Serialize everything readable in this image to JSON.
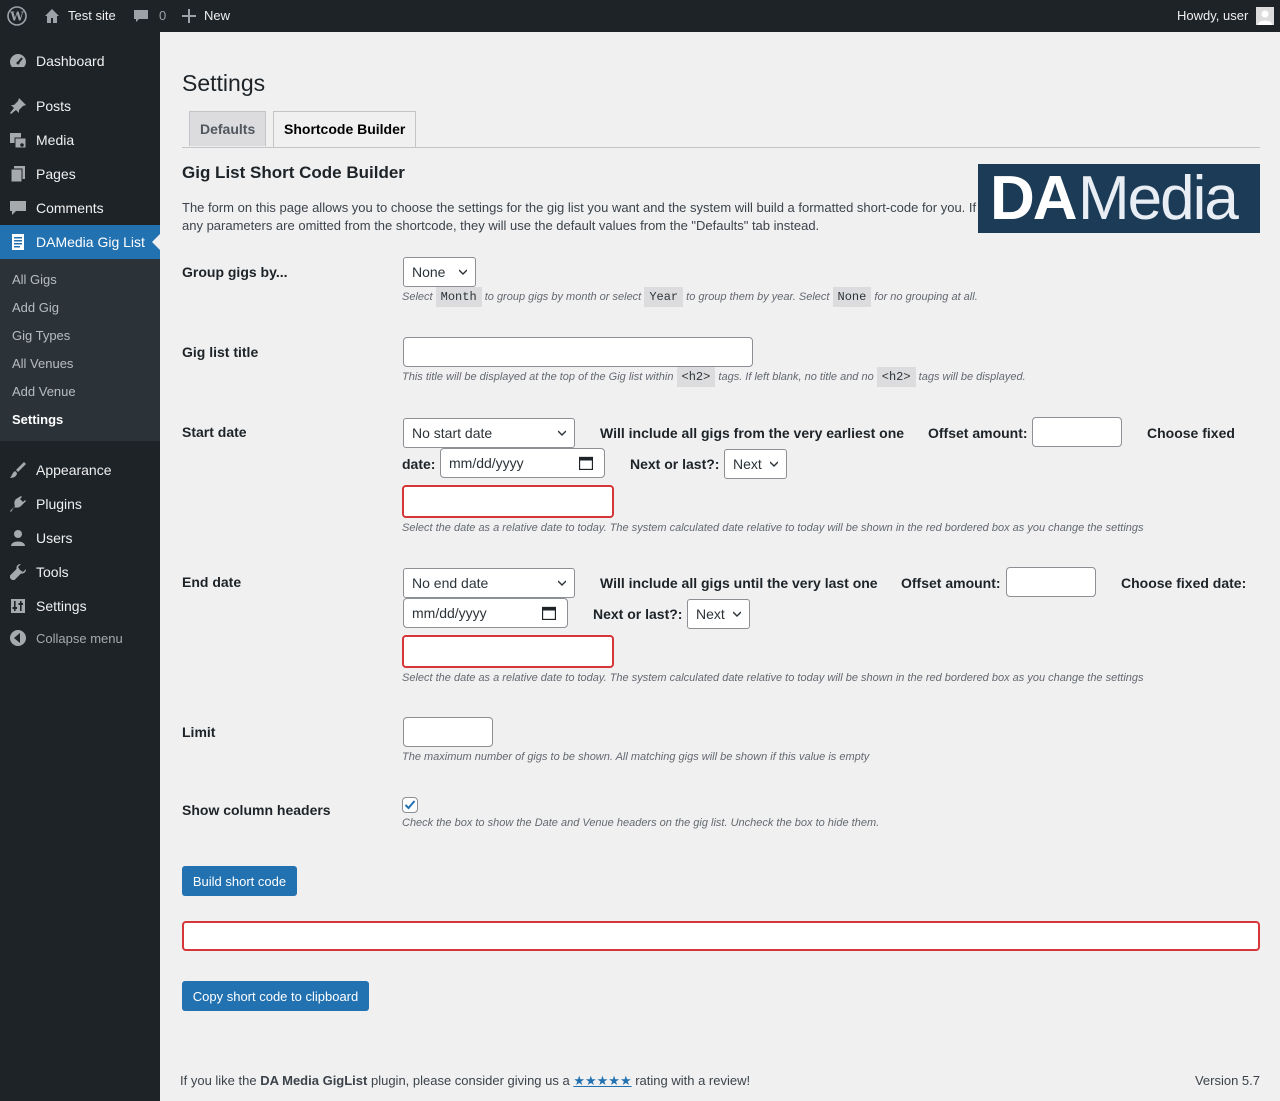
{
  "adminbar": {
    "site_name": "Test site",
    "comments_count": "0",
    "new_label": "New",
    "howdy": "Howdy, user"
  },
  "sidebar": {
    "items": [
      {
        "label": "Dashboard",
        "icon": "dashboard-icon"
      },
      {
        "label": "Posts",
        "icon": "pin-icon"
      },
      {
        "label": "Media",
        "icon": "media-icon"
      },
      {
        "label": "Pages",
        "icon": "pages-icon"
      },
      {
        "label": "Comments",
        "icon": "comments-icon"
      },
      {
        "label": "DAMedia Gig List",
        "icon": "document-icon"
      },
      {
        "label": "Appearance",
        "icon": "brush-icon"
      },
      {
        "label": "Plugins",
        "icon": "plug-icon"
      },
      {
        "label": "Users",
        "icon": "user-icon"
      },
      {
        "label": "Tools",
        "icon": "wrench-icon"
      },
      {
        "label": "Settings",
        "icon": "settings-icon"
      },
      {
        "label": "Collapse menu",
        "icon": "collapse-icon"
      }
    ],
    "submenu": [
      "All Gigs",
      "Add Gig",
      "Gig Types",
      "All Venues",
      "Add Venue",
      "Settings"
    ]
  },
  "page": {
    "title": "Settings",
    "tabs": [
      "Defaults",
      "Shortcode Builder"
    ],
    "heading": "Gig List Short Code Builder",
    "intro": "The form on this page allows you to choose the settings for the gig list you want and the system will build a formatted short-code for you. If any parameters are omitted from the shortcode, they will use the default values from the \"Defaults\" tab instead.",
    "logo_da": "DA",
    "logo_media": "Media"
  },
  "form": {
    "group": {
      "label": "Group gigs by...",
      "value": "None",
      "desc_1": "Select ",
      "code_1": "Month",
      "desc_2": " to group gigs by month or select ",
      "code_2": "Year",
      "desc_3": " to group them by year. Select ",
      "code_3": "None",
      "desc_4": " for no grouping at all."
    },
    "title": {
      "label": "Gig list title",
      "value": "",
      "desc_1": "This title will be displayed at the top of the Gig list within ",
      "code_1": "<h2>",
      "desc_2": " tags. If left blank, no title and no ",
      "code_2": "<h2>",
      "desc_3": " tags will be displayed."
    },
    "start": {
      "label": "Start date",
      "select_value": "No start date",
      "info": "Will include all gigs from the very earliest one",
      "offset_label": "Offset amount:",
      "fixed_label_1": "Choose fixed",
      "fixed_label_2": "date:",
      "date_placeholder": "mm/dd/yyyy",
      "next_label": "Next or last?:",
      "next_value": "Next",
      "desc": "Select the date as a relative date to today. The system calculated date relative to today will be shown in the red bordered box as you change the settings"
    },
    "end": {
      "label": "End date",
      "select_value": "No end date",
      "info": "Will include all gigs until the very last one",
      "offset_label": "Offset amount:",
      "fixed_label": "Choose fixed date:",
      "date_placeholder": "mm/dd/yyyy",
      "next_label": "Next or last?:",
      "next_value": "Next",
      "desc": "Select the date as a relative date to today. The system calculated date relative to today will be shown in the red bordered box as you change the settings"
    },
    "limit": {
      "label": "Limit",
      "value": "",
      "desc": "The maximum number of gigs to be shown. All matching gigs will be shown if this value is empty"
    },
    "headers": {
      "label": "Show column headers",
      "checked": true,
      "desc": "Check the box to show the Date and Venue headers on the gig list. Uncheck the box to hide them."
    },
    "build_button": "Build short code",
    "copy_button": "Copy short code to clipboard"
  },
  "footer": {
    "text_1": "If you like the ",
    "plugin_name": "DA Media GigList",
    "text_2": " plugin, please consider giving us a ",
    "stars": "★★★★★",
    "text_3": " rating with a review!",
    "version": "Version 5.7"
  },
  "colors": {
    "accent": "#2271b1",
    "sidebar_bg": "#1d2327",
    "error_border": "#d63638",
    "logo_bg": "#1c3b57"
  }
}
